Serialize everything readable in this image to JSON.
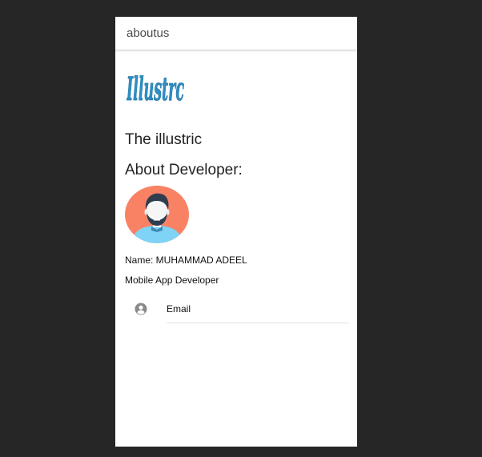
{
  "toolbar": {
    "title": "aboutus"
  },
  "logo": {
    "text": "Illustrc",
    "color": "#2d8fc4",
    "icon": "app-logo"
  },
  "main": {
    "app_name": "The illustric",
    "about_heading": "About Developer:",
    "avatar": {
      "icon": "developer-avatar",
      "background_color": "#fa8264",
      "shirt_color": "#7fd3f5"
    },
    "name_line": "Name: MUHAMMAD ADEEL",
    "role_line": "Mobile App Developer"
  },
  "contact": {
    "items": [
      {
        "icon": "person-circle-icon",
        "label": "Email"
      }
    ]
  }
}
